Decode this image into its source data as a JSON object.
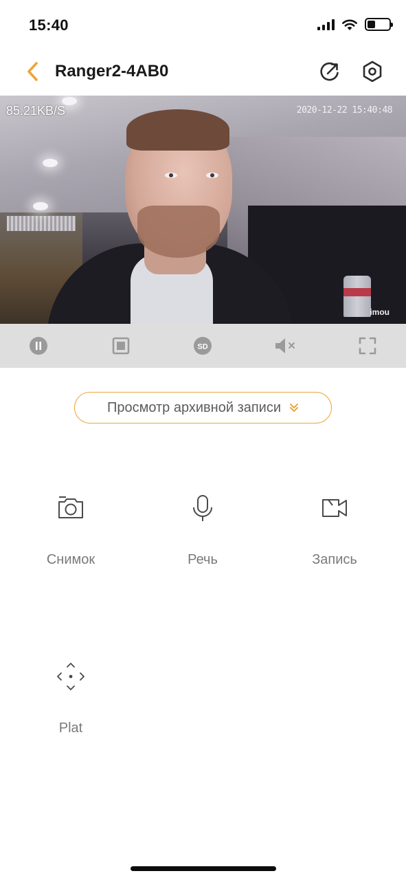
{
  "status_bar": {
    "time": "15:40",
    "icons": [
      "cellular-signal-icon",
      "wifi-icon",
      "battery-icon"
    ]
  },
  "nav": {
    "title": "Ranger2-4AB0",
    "back_icon": "chevron-left-icon",
    "share_icon": "share-icon",
    "settings_icon": "gear-icon",
    "accent_color": "#eba53d"
  },
  "video": {
    "bitrate": "85.21KB/S",
    "timestamp": "2020-12-22 15:40:48",
    "watermark": "imou"
  },
  "video_controls": {
    "items": [
      {
        "name": "pause-button",
        "icon": "pause-icon"
      },
      {
        "name": "stop-button",
        "icon": "stop-icon"
      },
      {
        "name": "quality-button",
        "icon": "sd-icon",
        "label": "SD"
      },
      {
        "name": "mute-button",
        "icon": "speaker-muted-icon"
      },
      {
        "name": "fullscreen-button",
        "icon": "fullscreen-icon"
      }
    ]
  },
  "playback": {
    "label": "Просмотр архивной записи",
    "icon": "double-chevron-down-icon"
  },
  "actions": [
    {
      "label": "Снимок",
      "icon": "camera-icon"
    },
    {
      "label": "Речь",
      "icon": "microphone-icon"
    },
    {
      "label": "Запись",
      "icon": "video-record-icon"
    },
    {
      "label": "Plat",
      "icon": "ptz-directions-icon"
    }
  ]
}
